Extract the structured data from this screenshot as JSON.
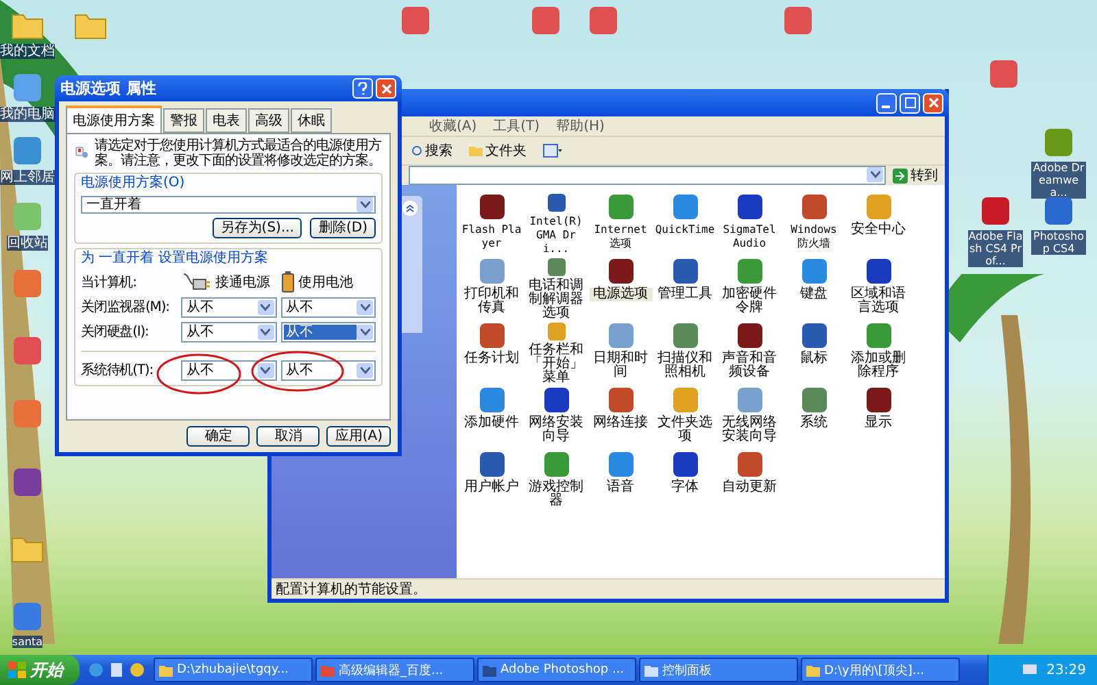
{
  "desktop_icons": [
    {
      "kind": "folder",
      "label": "我的文档"
    },
    {
      "kind": "computer",
      "label": "我的电脑"
    },
    {
      "kind": "network",
      "label": "网上邻居"
    },
    {
      "kind": "recycle",
      "label": "回收站"
    },
    {
      "kind": "image"
    },
    {
      "kind": "app"
    },
    {
      "kind": "image"
    },
    {
      "kind": "archive"
    },
    {
      "kind": "folder"
    },
    {
      "kind": "document",
      "label": "santa"
    },
    {
      "kind": "folder"
    },
    {
      "kind": "app"
    },
    {
      "kind": "app"
    },
    {
      "kind": "app"
    },
    {
      "kind": "app"
    },
    {
      "kind": "app"
    },
    {
      "kind": "dw",
      "label": "Adobe Dreamwea..."
    },
    {
      "kind": "fl",
      "label": "Adobe Flash CS4 Prof..."
    },
    {
      "kind": "ps",
      "label": "Photoshop CS4"
    }
  ],
  "control_panel": {
    "menu": [
      "收藏(A)",
      "工具(T)",
      "帮助(H)"
    ],
    "toolbar": [
      "搜索",
      "文件夹"
    ],
    "go_button": "转到",
    "items": [
      {
        "label": "Flash Player",
        "selected": false
      },
      {
        "label": "Intel(R) GMA Dri...",
        "selected": false
      },
      {
        "label": "Internet 选项",
        "selected": false
      },
      {
        "label": "QuickTime",
        "selected": false
      },
      {
        "label": "SigmaTel Audio",
        "selected": false
      },
      {
        "label": "Windows 防火墙",
        "selected": false
      },
      {
        "label": "安全中心",
        "selected": false
      },
      {
        "label": "打印机和传真",
        "selected": false
      },
      {
        "label": "电话和调制解调器选项",
        "selected": false
      },
      {
        "label": "电源选项",
        "selected": true
      },
      {
        "label": "管理工具",
        "selected": false
      },
      {
        "label": "加密硬件令牌",
        "selected": false
      },
      {
        "label": "键盘",
        "selected": false
      },
      {
        "label": "区域和语言选项",
        "selected": false
      },
      {
        "label": "任务计划",
        "selected": false
      },
      {
        "label": "任务栏和「开始」菜单",
        "selected": false
      },
      {
        "label": "日期和时间",
        "selected": false
      },
      {
        "label": "扫描仪和照相机",
        "selected": false
      },
      {
        "label": "声音和音频设备",
        "selected": false
      },
      {
        "label": "鼠标",
        "selected": false
      },
      {
        "label": "添加或删除程序",
        "selected": false
      },
      {
        "label": "添加硬件",
        "selected": false
      },
      {
        "label": "网络安装向导",
        "selected": false
      },
      {
        "label": "网络连接",
        "selected": false
      },
      {
        "label": "文件夹选项",
        "selected": false
      },
      {
        "label": "无线网络安装向导",
        "selected": false
      },
      {
        "label": "系统",
        "selected": false
      },
      {
        "label": "显示",
        "selected": false
      },
      {
        "label": "用户帐户",
        "selected": false
      },
      {
        "label": "游戏控制器",
        "selected": false
      },
      {
        "label": "语音",
        "selected": false
      },
      {
        "label": "字体",
        "selected": false
      },
      {
        "label": "自动更新",
        "selected": false
      }
    ],
    "status_bar": "配置计算机的节能设置。"
  },
  "dialog": {
    "title": "电源选项 属性",
    "tabs": [
      {
        "label": "电源使用方案",
        "selected": true
      },
      {
        "label": "警报",
        "selected": false
      },
      {
        "label": "电表",
        "selected": false
      },
      {
        "label": "高级",
        "selected": false
      },
      {
        "label": "休眠",
        "selected": false
      }
    ],
    "description": "请选定对于您使用计算机方式最适合的电源使用方案。请注意，更改下面的设置将修改选定的方案。",
    "scheme_group": {
      "label": "电源使用方案(O)",
      "value": "一直开着",
      "buttons": [
        "另存为(S)...",
        "删除(D)"
      ]
    },
    "settings_group": {
      "label": "为 一直开着 设置电源使用方案",
      "row_label": "当计算机:",
      "columns": [
        "接通电源",
        "使用电池"
      ],
      "rows": [
        {
          "label": "关闭监视器(M):",
          "values": [
            {
              "text": "从不",
              "selected": false
            },
            {
              "text": "从不",
              "selected": false
            }
          ]
        },
        {
          "label": "关闭硬盘(I):",
          "values": [
            {
              "text": "从不",
              "selected": false
            },
            {
              "text": "从不",
              "selected": true
            }
          ]
        },
        {
          "label": "系统待机(T):",
          "values": [
            {
              "text": "从不",
              "selected": false
            },
            {
              "text": "从不",
              "selected": false
            }
          ]
        }
      ]
    },
    "buttons": [
      "确定",
      "取消",
      "应用(A)"
    ]
  },
  "taskbar": {
    "start": "开始",
    "tasks": [
      "D:\\zhubajie\\tgqy...",
      "高级编辑器_百度...",
      "Adobe Photoshop ...",
      "控制面板",
      "D:\\y用的\\[顶尖]..."
    ],
    "clock": "23:29"
  }
}
